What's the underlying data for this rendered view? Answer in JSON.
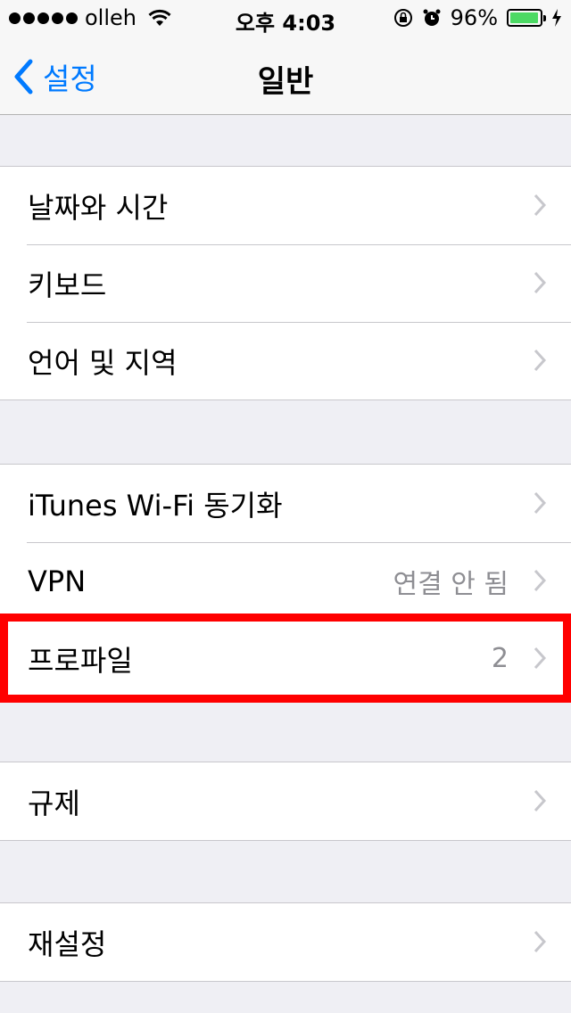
{
  "status_bar": {
    "carrier": "olleh",
    "time": "오후 4:03",
    "battery_percent": "96%",
    "battery_level": 0.96,
    "icons": [
      "signal-dots",
      "wifi-icon",
      "orientation-lock-icon",
      "alarm-icon",
      "battery-icon",
      "charging-icon"
    ]
  },
  "nav": {
    "back_label": "설정",
    "title": "일반"
  },
  "groups": {
    "g1": [
      {
        "label": "날짜와 시간"
      },
      {
        "label": "키보드"
      },
      {
        "label": "언어 및 지역"
      }
    ],
    "g2": [
      {
        "label": "iTunes Wi-Fi 동기화"
      },
      {
        "label": "VPN",
        "value": "연결 안 됨"
      },
      {
        "label": "프로파일",
        "value": "2"
      }
    ],
    "g3": [
      {
        "label": "규제"
      }
    ],
    "g4": [
      {
        "label": "재설정"
      }
    ]
  },
  "colors": {
    "accent": "#007aff",
    "background": "#efeff4",
    "highlight": "#ff0000",
    "battery": "#4cd964"
  }
}
